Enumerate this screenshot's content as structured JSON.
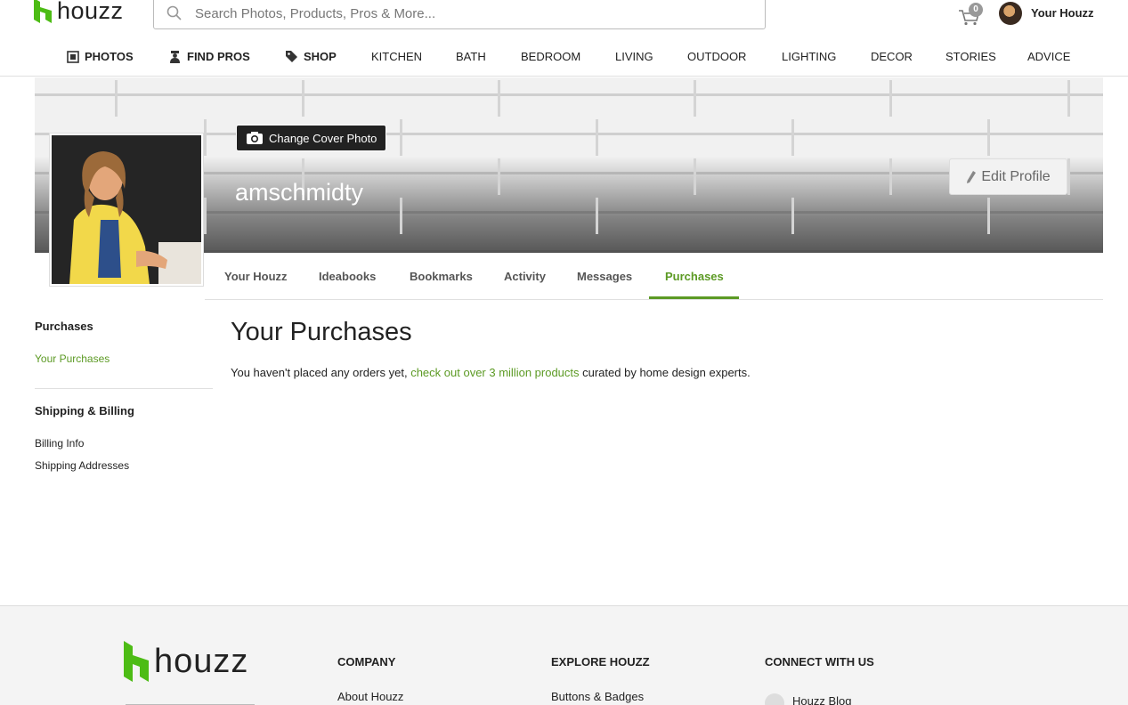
{
  "header": {
    "logo_text": "houzz",
    "search_placeholder": "Search Photos, Products, Pros & More...",
    "cart_count": "0",
    "user_label": "Your Houzz"
  },
  "nav": {
    "items": [
      {
        "label": "PHOTOS",
        "icon": "photos-icon"
      },
      {
        "label": "FIND PROS",
        "icon": "find-pros-icon"
      },
      {
        "label": "SHOP",
        "icon": "tag-icon"
      },
      {
        "label": "KITCHEN"
      },
      {
        "label": "BATH"
      },
      {
        "label": "BEDROOM"
      },
      {
        "label": "LIVING"
      },
      {
        "label": "OUTDOOR"
      },
      {
        "label": "LIGHTING"
      },
      {
        "label": "DECOR"
      },
      {
        "label": "STORIES"
      },
      {
        "label": "ADVICE"
      }
    ]
  },
  "profile": {
    "change_cover_label": "Change Cover Photo",
    "username": "amschmidty",
    "edit_profile_label": "Edit Profile"
  },
  "tabs": [
    {
      "label": "Your Houzz"
    },
    {
      "label": "Ideabooks"
    },
    {
      "label": "Bookmarks"
    },
    {
      "label": "Activity"
    },
    {
      "label": "Messages"
    },
    {
      "label": "Purchases",
      "active": true
    }
  ],
  "sidebar": {
    "purchases_heading": "Purchases",
    "your_purchases": "Your Purchases",
    "shipping_heading": "Shipping & Billing",
    "billing_info": "Billing Info",
    "shipping_addresses": "Shipping Addresses"
  },
  "main": {
    "title": "Your Purchases",
    "text_before": "You haven't placed any orders yet, ",
    "link_text": "check out over 3 million products",
    "text_after": " curated by home design experts."
  },
  "footer": {
    "logo_text": "houzz",
    "company_heading": "COMPANY",
    "company_link": "About Houzz",
    "explore_heading": "EXPLORE HOUZZ",
    "explore_link": "Buttons & Badges",
    "connect_heading": "CONNECT WITH US",
    "connect_link": "Houzz Blog"
  },
  "colors": {
    "accent_green": "#5c9a24",
    "logo_green": "#4dbc15"
  }
}
